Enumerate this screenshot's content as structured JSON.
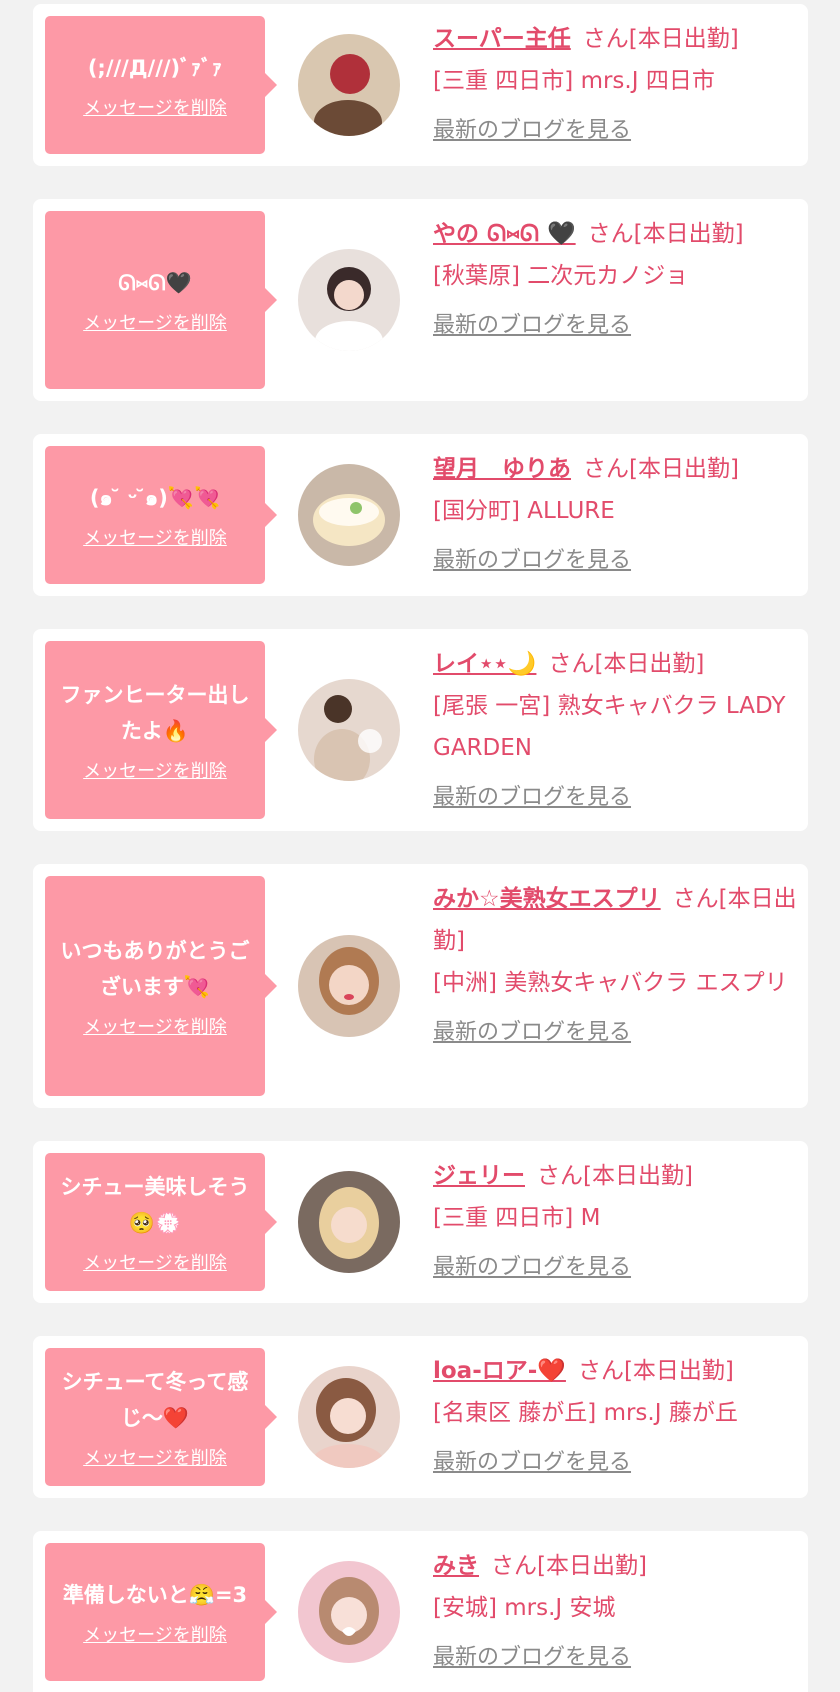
{
  "colors": {
    "accent": "#e24b6b",
    "bubble": "#fd99a6",
    "card": "#ffffff",
    "background": "#f2f2f2",
    "link_gray": "#8a8a8a"
  },
  "items": [
    {
      "message": "(;///Д///)ﾞｧﾞｧ",
      "delete_label": "メッセージを削除",
      "name": "スーパー主任",
      "status": "さん[本日出勤]",
      "shop": "[三重 四日市] mrs.J 四日市",
      "blog_label": "最新のブログを見る",
      "avatar_icon": "avatar-photo-icon"
    },
    {
      "message": "ᘏ⑅ᘏ🖤",
      "delete_label": "メッセージを削除",
      "name": "やの ᘏ⑅ᘏ 🖤",
      "status": "さん[本日出勤]",
      "shop": "[秋葉原] 二次元カノジョ",
      "blog_label": "最新のブログを見る",
      "avatar_icon": "avatar-photo-icon"
    },
    {
      "message": "(๑ ̆ ᵕ ̆๑)💘💘",
      "delete_label": "メッセージを削除",
      "name": "望月　ゆりあ",
      "status": "さん[本日出勤]",
      "shop": "[国分町] ALLURE",
      "blog_label": "最新のブログを見る",
      "avatar_icon": "avatar-photo-icon"
    },
    {
      "message": "ファンヒーター出したよ🔥",
      "delete_label": "メッセージを削除",
      "name": "レイ⋆⋆🌙",
      "status": "さん[本日出勤]",
      "shop": "[尾張 一宮] 熟女キャバクラ LADY GARDEN",
      "blog_label": "最新のブログを見る",
      "avatar_icon": "avatar-photo-icon"
    },
    {
      "message": "いつもありがとうございます💘",
      "delete_label": "メッセージを削除",
      "name": "みか☆美熟女エスプリ",
      "status": "さん[本日出勤]",
      "shop": "[中洲] 美熟女キャバクラ エスプリ",
      "blog_label": "最新のブログを見る",
      "avatar_icon": "avatar-photo-icon"
    },
    {
      "message": "シチュー美味しそう🥺💮",
      "delete_label": "メッセージを削除",
      "name": "ジェリー",
      "status": "さん[本日出勤]",
      "shop": "[三重 四日市] M",
      "blog_label": "最新のブログを見る",
      "avatar_icon": "avatar-photo-icon"
    },
    {
      "message": "シチューて冬って感じ〜❤️",
      "delete_label": "メッセージを削除",
      "name": "loa-ロア-❤️",
      "status": "さん[本日出勤]",
      "shop": "[名東区 藤が丘] mrs.J 藤が丘",
      "blog_label": "最新のブログを見る",
      "avatar_icon": "avatar-photo-icon"
    },
    {
      "message": "準備しないと😤=3",
      "delete_label": "メッセージを削除",
      "name": "みき",
      "status": "さん[本日出勤]",
      "shop": "[安城] mrs.J 安城",
      "blog_label": "最新のブログを見る",
      "avatar_icon": "avatar-photo-icon"
    }
  ]
}
